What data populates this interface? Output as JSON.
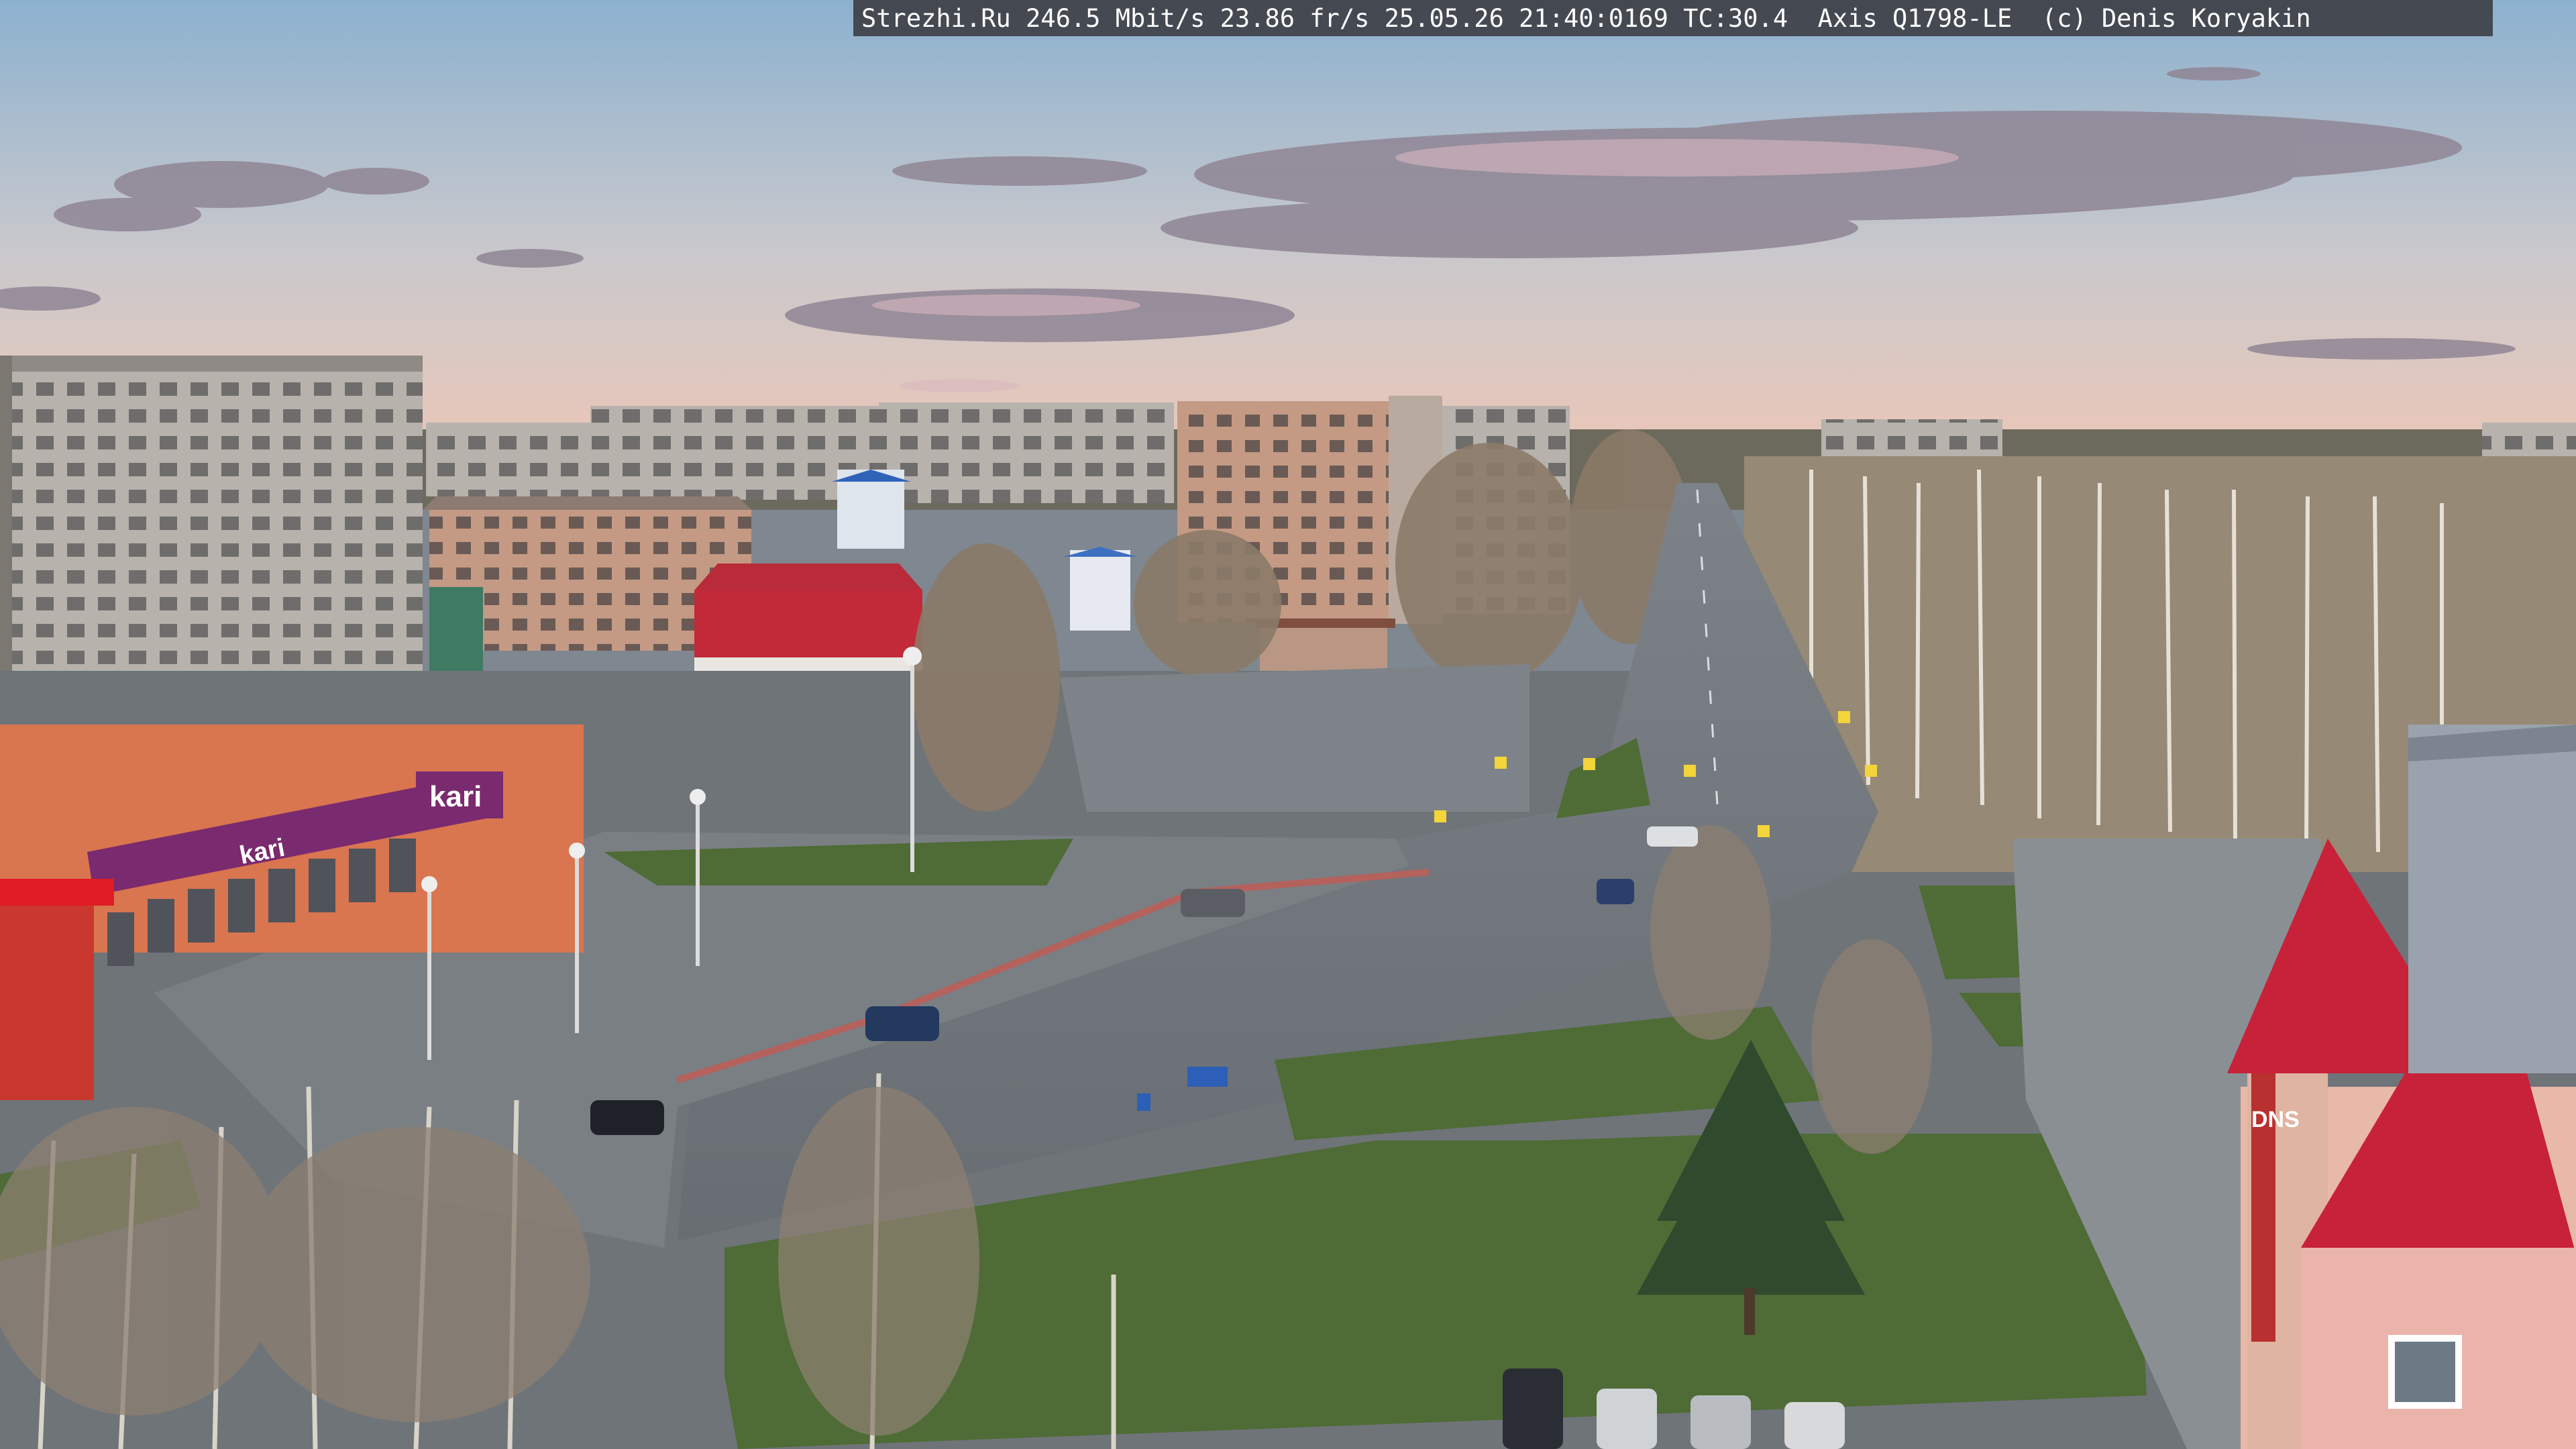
{
  "camera_overlay": {
    "text": "Strezhi.Ru 246.5 Mbit/s 23.86 fr/s 25.05.26 21:40:0169 TC:30.4  Axis Q1798-LE  (c) Denis Koryakin"
  },
  "scene": {
    "store_sign_logo": "kari",
    "store_facade_logo": "kari",
    "dns_sign": "DNS",
    "colors": {
      "sky_top": "#8fb0cc",
      "sky_horizon": "#e9c6b6",
      "road": "#6d7378",
      "grass": "#4d6b34",
      "kari_purple": "#7a2a6e",
      "roof_red": "#c8213a"
    }
  }
}
